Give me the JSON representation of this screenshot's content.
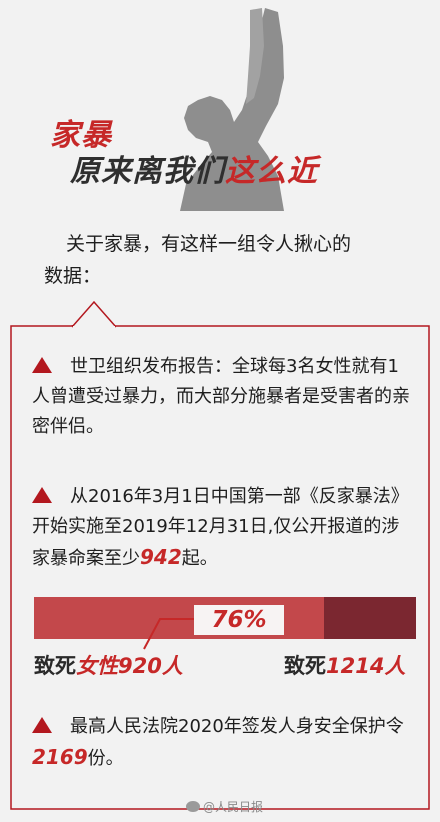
{
  "header": {
    "title_line1": "家暴",
    "title_line2_prefix": "原来离我们",
    "title_line2_highlight": "这么近"
  },
  "intro": {
    "text_line1": "关于家暴，有这样一组令人揪心的",
    "text_line2": "数据："
  },
  "items": [
    {
      "text": "世卫组织发布报告：全球每3名女性就有1人曾遭受过暴力，而大部分施暴者是受害者的亲密伴侣。"
    },
    {
      "text_before": "从2016年3月1日中国第一部《反家暴法》开始实施至2019年12月31日,仅公开报道的涉家暴命案至少",
      "number": "942",
      "text_after": "起。"
    },
    {
      "text_before": "最高人民法院2020年签发人身安全保护令",
      "number": "2169",
      "text_after": "份。"
    }
  ],
  "bar": {
    "percent_label": "76%",
    "female_share": 0.76,
    "left_prefix": "致死",
    "left_highlight": "女性920人",
    "right_prefix": "致死",
    "right_highlight": "1214人",
    "colors": {
      "female": "#c3484b",
      "total": "#7b2730"
    }
  },
  "watermark": {
    "icon": "weibo-icon",
    "text": "@人民日报"
  },
  "colors": {
    "accent": "#c62828",
    "background": "#f2f2f2",
    "frame": "#b3181f"
  }
}
